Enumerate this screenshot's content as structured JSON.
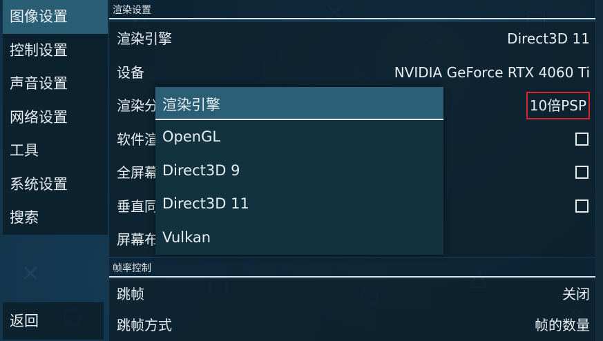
{
  "sidebar": {
    "items": [
      {
        "label": "图像设置",
        "active": true
      },
      {
        "label": "控制设置",
        "active": false
      },
      {
        "label": "声音设置",
        "active": false
      },
      {
        "label": "网络设置",
        "active": false
      },
      {
        "label": "工具",
        "active": false
      },
      {
        "label": "系统设置",
        "active": false
      },
      {
        "label": "搜索",
        "active": false
      }
    ],
    "back_label": "返回"
  },
  "render_section": {
    "header": "渲染设置",
    "rows": [
      {
        "label": "渲染引擎",
        "value": "Direct3D 11"
      },
      {
        "label": "设备",
        "value": "NVIDIA GeForce RTX 4060 Ti"
      },
      {
        "label": "渲染分",
        "value": "10倍PSP"
      },
      {
        "label": "软件渲",
        "checked": false
      },
      {
        "label": "全屏幕",
        "checked": false
      },
      {
        "label": "垂直同",
        "checked": false
      },
      {
        "label": "屏幕布"
      }
    ]
  },
  "framerate_section": {
    "header": "帧率控制",
    "rows": [
      {
        "label": "跳帧",
        "value": "关闭"
      },
      {
        "label": "跳帧方式",
        "value": "帧的数量"
      }
    ]
  },
  "popup": {
    "title": "渲染引擎",
    "options": [
      "OpenGL",
      "Direct3D 9",
      "Direct3D 11",
      "Vulkan"
    ]
  },
  "colors": {
    "background": "#0f2f45",
    "active_item": "#2a5e74",
    "highlight_box": "#d9252a"
  }
}
